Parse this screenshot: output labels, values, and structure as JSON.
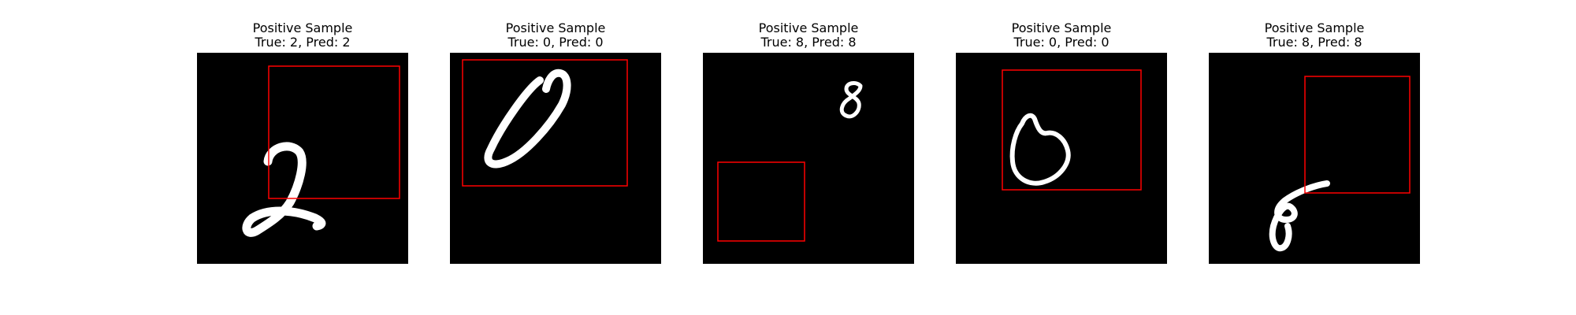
{
  "panels": [
    {
      "title": "Positive Sample",
      "subtitle": "True: 2, Pred: 2",
      "digit": "2"
    },
    {
      "title": "Positive Sample",
      "subtitle": "True: 0, Pred: 0",
      "digit": "0"
    },
    {
      "title": "Positive Sample",
      "subtitle": "True: 8, Pred: 8",
      "digit": "8"
    },
    {
      "title": "Positive Sample",
      "subtitle": "True: 0, Pred: 0",
      "digit": "0"
    },
    {
      "title": "Positive Sample",
      "subtitle": "True: 8, Pred: 8",
      "digit": "8"
    }
  ],
  "colors": {
    "background": "#000000",
    "stroke": "#ffffff",
    "box": "#ff0000"
  }
}
